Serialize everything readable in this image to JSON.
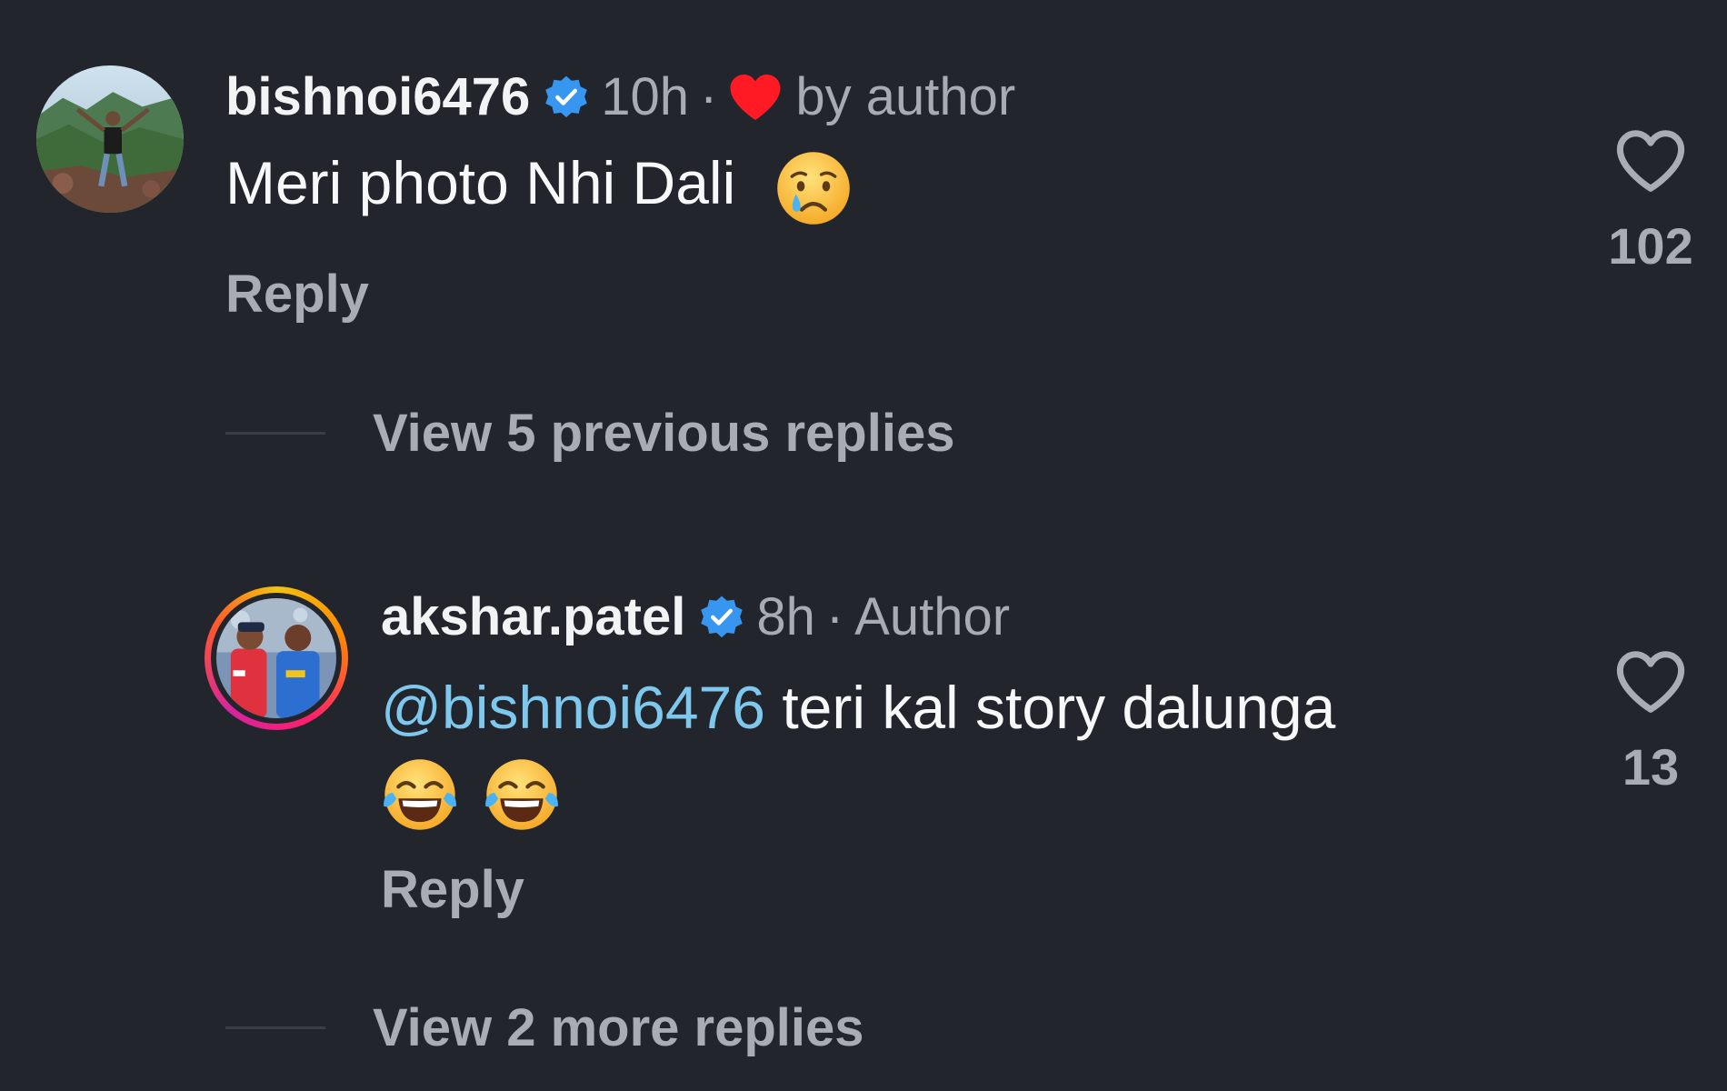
{
  "comment": {
    "username": "bishnoi6476",
    "time": "10h",
    "liked_by_author_label": "by author",
    "text": "Meri photo Nhi Dali",
    "emoji": "crying-face",
    "reply_label": "Reply",
    "likes": "102"
  },
  "view_previous_replies": "View 5 previous replies",
  "reply": {
    "username": "akshar.patel",
    "time": "8h",
    "author_label": "Author",
    "mention": "@bishnoi6476",
    "text": " teri kal story dalunga",
    "emojis": [
      "face-with-tears-of-joy",
      "face-with-tears-of-joy"
    ],
    "reply_label": "Reply",
    "likes": "13"
  },
  "view_more_replies": "View 2 more replies",
  "colors": {
    "background": "#22252c",
    "verified": "#3797f0",
    "mention": "#7ec8ee",
    "heart": "#ff1a24",
    "muted": "#a9acb3"
  },
  "icons": [
    "verified-badge-icon",
    "heart-icon",
    "like-heart-outline-icon"
  ]
}
